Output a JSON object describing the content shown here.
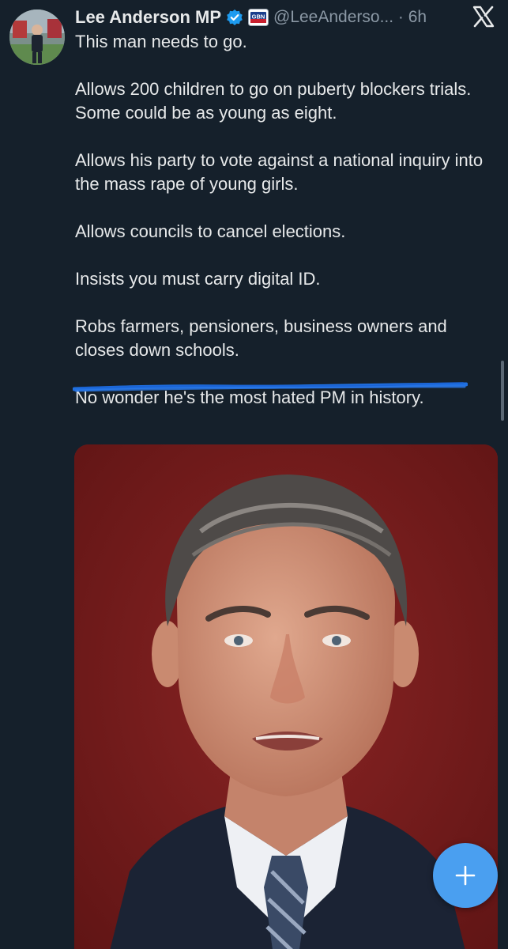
{
  "tweet": {
    "author_name": "Lee Anderson MP",
    "handle_time": "@LeeAnderso... · 6h",
    "affiliate_badge": "GB News",
    "paragraphs": [
      "This man needs to go.",
      "Allows 200 children to go on puberty blockers trials.\nSome could be as young as eight.",
      "Allows his party to vote against a national inquiry into the mass rape of young girls.",
      "Allows councils to cancel elections.",
      "Insists you must carry digital ID.",
      "Robs farmers, pensioners, business owners and closes down schools.",
      "No wonder he's the most hated PM in history."
    ],
    "image_alt": "Photo of a man in a suit and tie against a dark red background"
  },
  "colors": {
    "background": "#15202b",
    "text_primary": "#e7e9ea",
    "text_secondary": "#8b98a5",
    "verified": "#1d9bf0",
    "scribble": "#1f6fe0",
    "fab": "#4a9ff0"
  },
  "icons": {
    "verified": "verified-badge-icon",
    "affiliate": "gbn-affiliate-icon",
    "close": "x-logo-icon",
    "compose": "plus-icon"
  }
}
